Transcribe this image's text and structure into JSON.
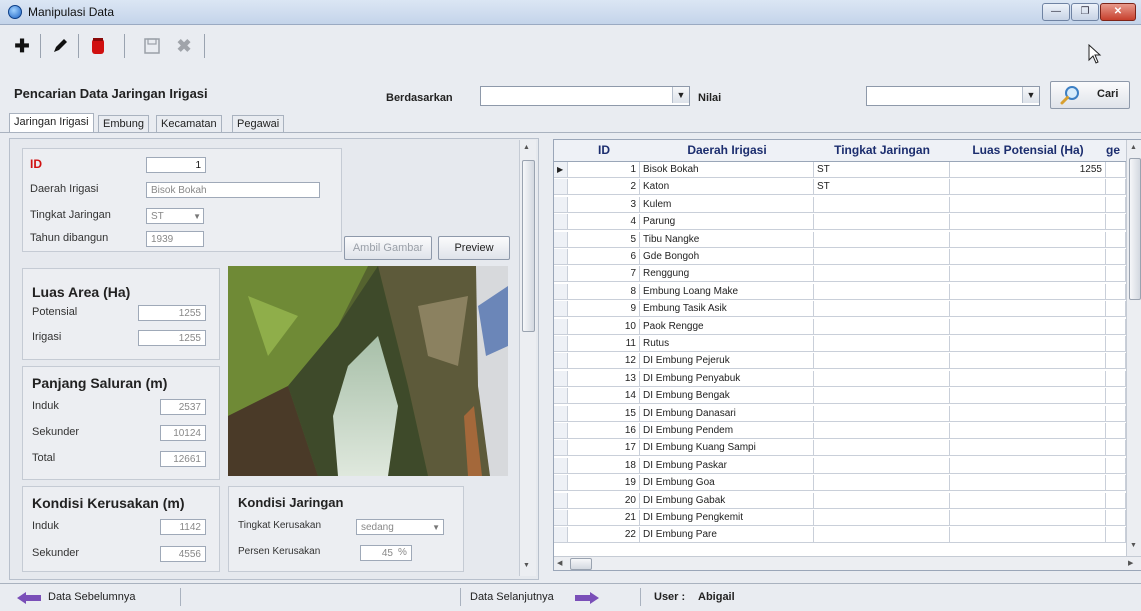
{
  "window": {
    "title": "Manipulasi Data"
  },
  "header": {
    "title": "Pencarian Data Jaringan Irigasi",
    "berdasarkan_label": "Berdasarkan",
    "berdasarkan_value": "",
    "nilai_label": "Nilai",
    "nilai_value": "",
    "cari_label": "Cari"
  },
  "tabs": [
    {
      "label": "Jaringan Irigasi",
      "active": true
    },
    {
      "label": "Embung",
      "active": false
    },
    {
      "label": "Kecamatan",
      "active": false
    },
    {
      "label": "Pegawai",
      "active": false
    }
  ],
  "form": {
    "id_label": "ID",
    "id_value": "1",
    "daerah_label": "Daerah Irigasi",
    "daerah_value": "Bisok Bokah",
    "tingkat_label": "Tingkat Jaringan",
    "tingkat_value": "ST",
    "tahun_label": "Tahun dibangun",
    "tahun_value": "1939",
    "ambil_gambar_label": "Ambil Gambar",
    "preview_label": "Preview",
    "luas": {
      "title": "Luas Area (Ha)",
      "potensial_label": "Potensial",
      "potensial_value": "1255",
      "irigasi_label": "Irigasi",
      "irigasi_value": "1255"
    },
    "panjang": {
      "title": "Panjang Saluran (m)",
      "induk_label": "Induk",
      "induk_value": "2537",
      "sekunder_label": "Sekunder",
      "sekunder_value": "10124",
      "total_label": "Total",
      "total_value": "12661"
    },
    "kerusakan": {
      "title": "Kondisi Kerusakan (m)",
      "induk_label": "Induk",
      "induk_value": "1142",
      "sekunder_label": "Sekunder",
      "sekunder_value": "4556"
    },
    "kondisi": {
      "title": "Kondisi Jaringan",
      "tingkat_label": "Tingkat Kerusakan",
      "tingkat_value": "sedang",
      "persen_label": "Persen Kerusakan",
      "persen_value": "45",
      "persen_unit": "%"
    }
  },
  "grid": {
    "columns": [
      "ID",
      "Daerah Irigasi",
      "Tingkat Jaringan",
      "Luas Potensial (Ha)",
      "ge"
    ],
    "rows": [
      [
        "1",
        "Bisok Bokah",
        "ST",
        "1255"
      ],
      [
        "2",
        "Katon",
        "ST",
        ""
      ],
      [
        "3",
        "Kulem",
        "",
        ""
      ],
      [
        "4",
        "Parung",
        "",
        ""
      ],
      [
        "5",
        "Tibu Nangke",
        "",
        ""
      ],
      [
        "6",
        "Gde Bongoh",
        "",
        ""
      ],
      [
        "7",
        "Renggung",
        "",
        ""
      ],
      [
        "8",
        "Embung Loang Make",
        "",
        ""
      ],
      [
        "9",
        "Embung Tasik Asik",
        "",
        ""
      ],
      [
        "10",
        "Paok Rengge",
        "",
        ""
      ],
      [
        "11",
        "Rutus",
        "",
        ""
      ],
      [
        "12",
        "DI Embung Pejeruk",
        "",
        ""
      ],
      [
        "13",
        "DI Embung Penyabuk",
        "",
        ""
      ],
      [
        "14",
        "DI Embung Bengak",
        "",
        ""
      ],
      [
        "15",
        "DI Embung Danasari",
        "",
        ""
      ],
      [
        "16",
        "DI Embung Pendem",
        "",
        ""
      ],
      [
        "17",
        "DI Embung Kuang Sampi",
        "",
        ""
      ],
      [
        "18",
        "DI Embung Paskar",
        "",
        ""
      ],
      [
        "19",
        "DI Embung Goa",
        "",
        ""
      ],
      [
        "20",
        "DI Embung Gabak",
        "",
        ""
      ],
      [
        "21",
        "DI Embung Pengkemit",
        "",
        ""
      ],
      [
        "22",
        "DI Embung Pare",
        "",
        ""
      ]
    ]
  },
  "status": {
    "prev_label": "Data Sebelumnya",
    "next_label": "Data Selanjutnya",
    "user_label": "User :",
    "user_name": "Abigail"
  },
  "icons": {
    "app": "app-icon",
    "add": "plus-icon",
    "edit": "pencil-icon",
    "delete": "trash-icon",
    "save": "save-icon",
    "cancel": "cancel-icon",
    "search": "magnifier-icon",
    "prev": "arrow-left-icon",
    "next": "arrow-right-icon"
  },
  "colors": {
    "accent_red": "#d01010",
    "header_text": "#1b2d6e",
    "nav_arrow": "#7a4fb8"
  }
}
